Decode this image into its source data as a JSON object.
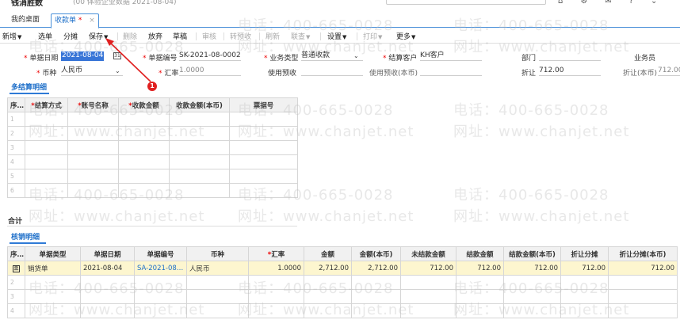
{
  "window": {
    "title": "钱消胜数",
    "subtitle": "(00 体验企业数据 2021-08-04)"
  },
  "tabs": [
    {
      "label": "我的桌面"
    },
    {
      "label": "收款单",
      "marker": "*",
      "close": "×"
    }
  ],
  "toolbar": {
    "new": "新增",
    "select": "选单",
    "split": "分摊",
    "save": "保存",
    "delete": "删除",
    "discard": "放弃",
    "draft": "草稿",
    "audit": "审核",
    "to_prepay": "转预收",
    "refresh": "刷新",
    "query": "联查",
    "settings": "设置",
    "print": "打印",
    "more": "更多"
  },
  "form": {
    "doc_date_label": "单据日期",
    "doc_date": "2021-08-04",
    "doc_no_label": "单据编号",
    "doc_no": "SK-2021-08-0002",
    "biz_type_label": "业务类型",
    "biz_type": "普通收款",
    "customer_label": "结算客户",
    "customer": "KH客户",
    "dept_label": "部门",
    "dept": "",
    "salesman_label": "业务员",
    "currency_label": "币种",
    "currency": "人民币",
    "rate_label": "汇率",
    "rate": "1.0000",
    "use_prepay_label": "使用预收",
    "use_prepay_local_label": "使用预收(本币)",
    "discount_label": "折让",
    "discount": "712.00",
    "discount_local_label": "折让(本币)",
    "discount_local": "712.00"
  },
  "multi_settle": {
    "title": "多结算明细",
    "columns": [
      "序号",
      "结算方式",
      "账号名称",
      "收款金额",
      "收款金额(本币)",
      "票据号"
    ],
    "required": [
      false,
      true,
      true,
      true,
      false,
      false
    ],
    "row_numbers": [
      "1",
      "2",
      "3",
      "4",
      "5",
      "6"
    ],
    "total_label": "合计"
  },
  "writeoff": {
    "title": "核销明细",
    "columns": [
      "序号",
      "单据类型",
      "单据日期",
      "单据编号",
      "币种",
      "汇率",
      "金额",
      "金额(本币)",
      "未结款金额",
      "结款金额",
      "结款金额(本币)",
      "折让分摊",
      "折让分摊(本币)"
    ],
    "required": [
      false,
      false,
      false,
      false,
      false,
      true,
      false,
      false,
      false,
      false,
      false,
      false,
      false
    ],
    "rows": [
      {
        "no": "",
        "type": "销货单",
        "date": "2021-08-04",
        "doc_no": "SA-2021-08-...",
        "currency": "人民币",
        "rate": "1.0000",
        "amount": "2,712.00",
        "amount_local": "2,712.00",
        "unsettled": "712.00",
        "settled": "712.00",
        "settled_local": "712.00",
        "disc": "712.00",
        "disc_local": "712.00"
      }
    ],
    "empty_row_numbers": [
      "2",
      "3",
      "4"
    ]
  },
  "watermark": {
    "phone": "电话：400-665-0028",
    "site": "网址：www.chanjet.net"
  },
  "annotation": {
    "badge": "1",
    "color": "#e02020"
  }
}
